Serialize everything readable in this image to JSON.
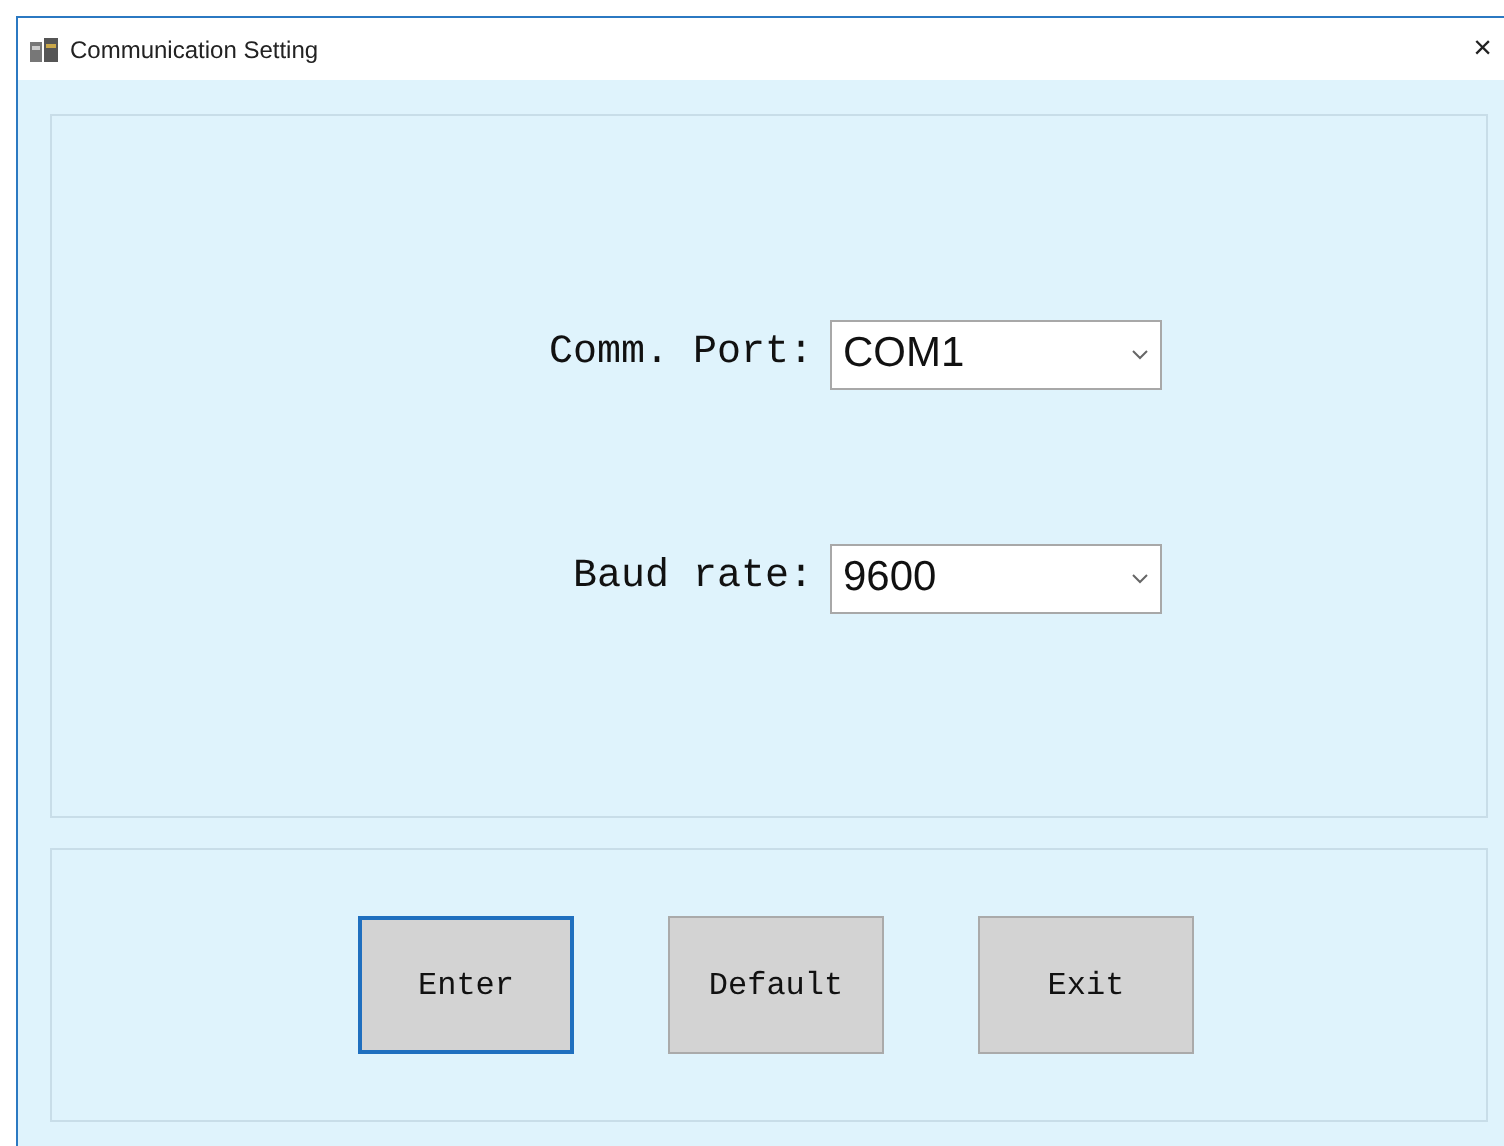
{
  "window": {
    "title": "Communication Setting",
    "close": "×"
  },
  "fields": [
    {
      "label": "Comm. Port:",
      "value": "COM1"
    },
    {
      "label": "Baud rate:",
      "value": "9600"
    }
  ],
  "buttons": [
    {
      "label": "Enter",
      "focused": true
    },
    {
      "label": "Default",
      "focused": false
    },
    {
      "label": "Exit",
      "focused": false
    }
  ]
}
